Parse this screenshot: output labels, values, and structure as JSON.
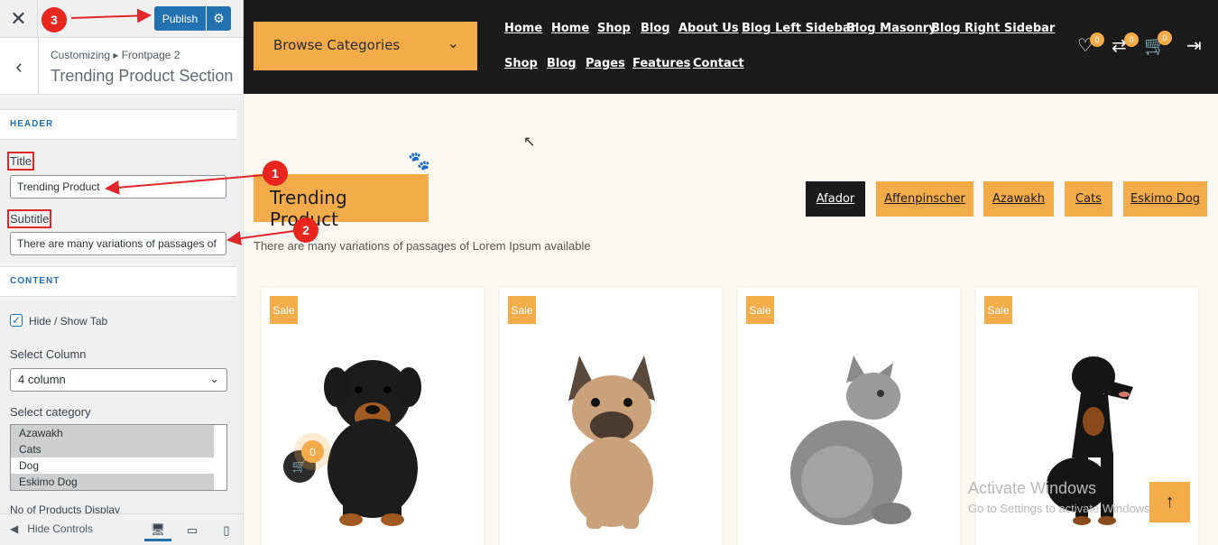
{
  "customizer": {
    "close_label": "✕",
    "publish_label": "Publish",
    "breadcrumb": "Customizing ▸ Frontpage 2",
    "section_title": "Trending Product Section",
    "header_group": "HEADER",
    "title_label": "Title",
    "title_value": "Trending Product",
    "subtitle_label": "Subtitle",
    "subtitle_value": "There are many variations of passages of Lorem Ipsum available",
    "content_group": "CONTENT",
    "hide_show_tab_label": "Hide / Show Tab",
    "hide_show_tab_checked": true,
    "select_column_label": "Select Column",
    "select_column_value": "4 column",
    "select_category_label": "Select category",
    "categories": [
      {
        "label": "Azawakh",
        "selected": true
      },
      {
        "label": "Cats",
        "selected": true
      },
      {
        "label": "Dog",
        "selected": false
      },
      {
        "label": "Eskimo Dog",
        "selected": true
      }
    ],
    "products_display_label": "No of Products Display",
    "hide_controls_label": "Hide Controls"
  },
  "annotations": [
    "1",
    "2",
    "3"
  ],
  "site": {
    "browse_label": "Browse Categories",
    "nav_row1": [
      "Home",
      "Home",
      "Shop",
      "Blog",
      "About Us",
      "Blog Left Sidebar",
      "Blog Masonry",
      "Blog Right Sidebar"
    ],
    "nav_row2": [
      "Shop",
      "Blog",
      "Pages",
      "Features",
      "Contact"
    ],
    "wishlist_count": "0",
    "compare_count": "0",
    "cart_count": "0",
    "section_title": "Trending Product",
    "section_subtitle": "There are many variations of passages of Lorem Ipsum available",
    "tabs": [
      "Afador",
      "Affenpinscher",
      "Azawakh",
      "Cats",
      "Eskimo Dog"
    ],
    "active_tab": "Afador",
    "products": [
      {
        "badge": "Sale",
        "pet": "rottweiler-puppy"
      },
      {
        "badge": "Sale",
        "pet": "french-bulldog"
      },
      {
        "badge": "Sale",
        "pet": "grey-kitten"
      },
      {
        "badge": "Sale",
        "pet": "doberman"
      }
    ],
    "floating_cart_count": "0",
    "watermark_line1": "Activate Windows",
    "watermark_line2": "Go to Settings to activate Windows."
  },
  "colors": {
    "accent": "#f4ac4a",
    "dark": "#1b1b1b",
    "wp_blue": "#2271b1",
    "annotation_red": "#e0262b"
  }
}
